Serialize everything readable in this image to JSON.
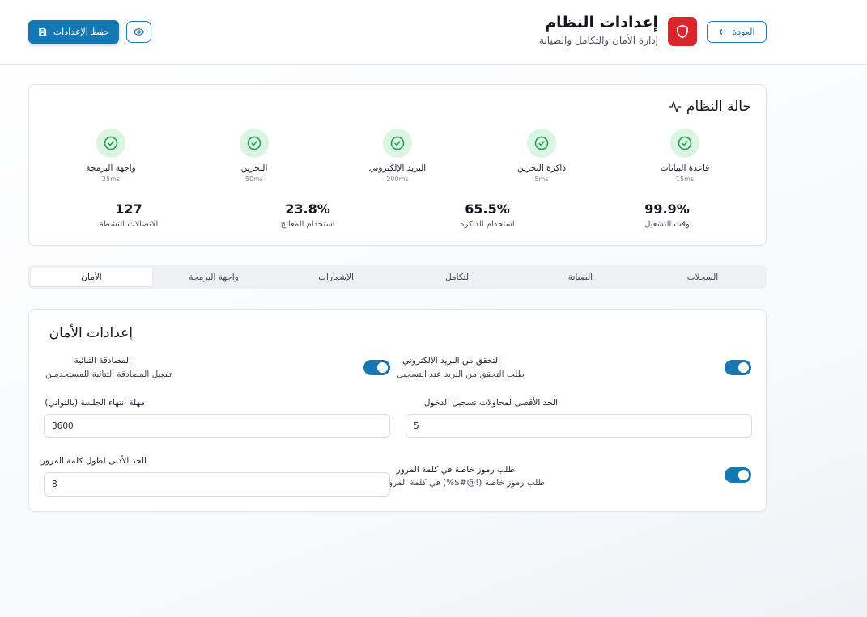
{
  "header": {
    "title": "إعدادات النظام",
    "subtitle": "إدارة الأمان والتكامل والصيانة",
    "back_label": "العودة",
    "save_label": "حفظ الإعدادات"
  },
  "status": {
    "title": "حالة النظام",
    "services": [
      {
        "name": "قاعدة البيانات",
        "latency": "15ms"
      },
      {
        "name": "ذاكرة التخزين",
        "latency": "5ms"
      },
      {
        "name": "البريد الإلكتروني",
        "latency": "200ms"
      },
      {
        "name": "التخزين",
        "latency": "50ms"
      },
      {
        "name": "واجهة البرمجة",
        "latency": "25ms"
      }
    ],
    "metrics": [
      {
        "value": "99.9%",
        "label": "وقت التشغيل"
      },
      {
        "value": "65.5%",
        "label": "استخدام الذاكرة"
      },
      {
        "value": "23.8%",
        "label": "استخدام المعالج"
      },
      {
        "value": "127",
        "label": "الاتصالات النشطة"
      }
    ]
  },
  "tabs": [
    "السجلات",
    "الصيانة",
    "التكامل",
    "الإشعارات",
    "واجهة البرمجة",
    "الأمان"
  ],
  "active_tab": "الأمان",
  "security": {
    "title": "إعدادات الأمان",
    "email_verification": {
      "label": "التحقق من البريد الإلكتروني",
      "desc": "طلب التحقق من البريد عند التسجيل",
      "enabled": true
    },
    "two_factor": {
      "label": "المصادقة الثنائية",
      "desc": "تفعيل المصادقة الثنائية للمستخدمين",
      "enabled": true
    },
    "max_login_attempts": {
      "label": "الحد الأقصى لمحاولات تسجيل الدخول",
      "value": "5"
    },
    "session_timeout": {
      "label": "مهلة انتهاء الجلسة (بالثواني)",
      "value": "3600"
    },
    "special_chars": {
      "label": "طلب رموز خاصة في كلمة المرور",
      "desc": "طلب رموز خاصة (!@#$%) في كلمة المرور",
      "enabled": true
    },
    "min_password_length": {
      "label": "الحد الأدنى لطول كلمة المرور",
      "value": "8"
    }
  },
  "colors": {
    "accent": "#1578b3",
    "danger": "#d8262c",
    "success_bg": "#dcf5e3",
    "success": "#22a55b"
  }
}
